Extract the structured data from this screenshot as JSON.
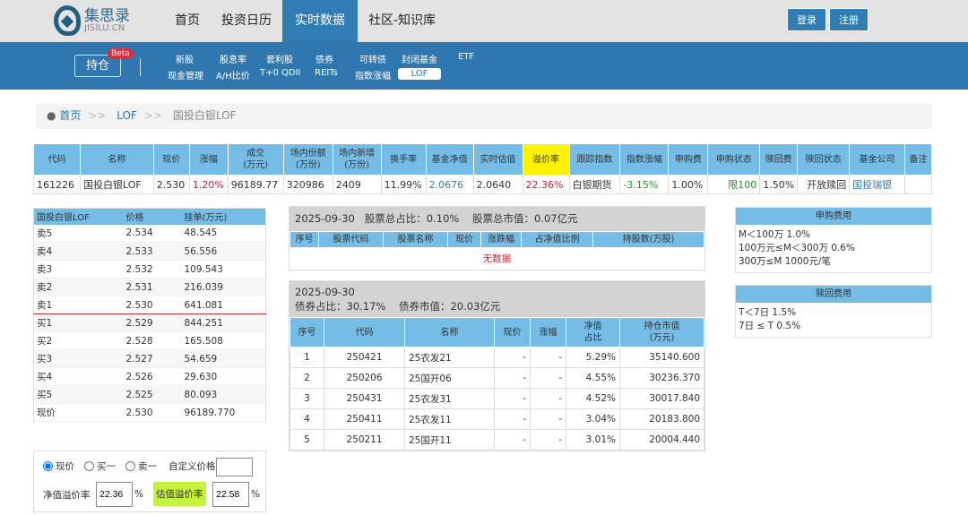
{
  "header": {
    "logo_cn": "集思录",
    "logo_en": "JISILU.CN",
    "nav": [
      "首页",
      "投资日历",
      "实时数据",
      "社区-知识库"
    ],
    "active_nav": "实时数据",
    "login": "登录",
    "register": "注册"
  },
  "subnav": {
    "hold": "持仓",
    "beta": "Beta",
    "row1": [
      "新股",
      "股息率",
      "套利股",
      "债券",
      "可转债",
      "封闭基金",
      "ETF"
    ],
    "row2": [
      "现金管理",
      "A/H比价",
      "T+0 QDII",
      "REITs",
      "指数涨幅",
      "LOF"
    ],
    "active": "LOF"
  },
  "breadcrumb": {
    "home": "首页",
    "lof": "LOF",
    "current": "国投白银LOF",
    "sep": ">>"
  },
  "main_table": {
    "headers": [
      "代码",
      "名称",
      "现价",
      "涨幅",
      "成交\n(万元)",
      "场内份额\n(万份)",
      "场内新增\n(万份)",
      "换手率",
      "基金净值",
      "实时估值",
      "溢价率",
      "跟踪指数",
      "指数涨幅",
      "申购费",
      "申购状态",
      "赎回费",
      "赎回状态",
      "基金公司",
      "备注"
    ],
    "row": [
      "161226",
      "国投白银LOF",
      "2.530",
      "1.20%",
      "96189.77",
      "320986",
      "2409",
      "11.99%",
      "2.0676",
      "2.0640",
      "22.36%",
      "白银期货",
      "-3.15%",
      "1.00%",
      "限100",
      "1.50%",
      "开放赎回",
      "国投瑞银",
      ""
    ]
  },
  "order_book": {
    "headers": [
      "国投白银LOF",
      "价格",
      "挂单(万元)"
    ],
    "rows": [
      [
        "卖5",
        "2.534",
        "48.545"
      ],
      [
        "卖4",
        "2.533",
        "56.556"
      ],
      [
        "卖3",
        "2.532",
        "109.543"
      ],
      [
        "卖2",
        "2.531",
        "216.039"
      ],
      [
        "卖1",
        "2.530",
        "641.081"
      ],
      [
        "买1",
        "2.529",
        "844.251"
      ],
      [
        "买2",
        "2.528",
        "165.508"
      ],
      [
        "买3",
        "2.527",
        "54.659"
      ],
      [
        "买4",
        "2.526",
        "29.630"
      ],
      [
        "买5",
        "2.525",
        "80.093"
      ],
      [
        "现价",
        "2.530",
        "96189.770"
      ]
    ]
  },
  "calc": {
    "opt_now": "现价",
    "opt_buy1": "买一",
    "opt_sell1": "卖一",
    "custom_label": "自定义价格",
    "custom_value": "",
    "nav_premium_label": "净值溢价率",
    "nav_premium": "22.36",
    "est_premium_label": "估值溢价率",
    "est_premium": "22.58",
    "pct": "%"
  },
  "stocks": {
    "date": "2025-09-30",
    "ratio_label": "股票总占比：0.10%",
    "value_label": "股票总市值：0.07亿元",
    "headers": [
      "序号",
      "股票代码",
      "股票名称",
      "现价",
      "涨跌幅",
      "占净值比例",
      "持股数(万股)"
    ],
    "empty": "无数据"
  },
  "bonds": {
    "date": "2025-09-30",
    "ratio_label": "债券占比：30.17%",
    "value_label": "债券市值：20.03亿元",
    "headers": [
      "序号",
      "代码",
      "名称",
      "现价",
      "涨幅",
      "净值\n占比",
      "持仓市值\n(万元)"
    ],
    "rows": [
      [
        "1",
        "250421",
        "25农发21",
        "-",
        "-",
        "5.29%",
        "35140.600"
      ],
      [
        "2",
        "250206",
        "25国开06",
        "-",
        "-",
        "4.55%",
        "30236.370"
      ],
      [
        "3",
        "250431",
        "25农发31",
        "-",
        "-",
        "4.52%",
        "30017.840"
      ],
      [
        "4",
        "250411",
        "25农发11",
        "-",
        "-",
        "3.04%",
        "20183.800"
      ],
      [
        "5",
        "250211",
        "25国开11",
        "-",
        "-",
        "3.01%",
        "20004.440"
      ]
    ]
  },
  "purchase_fee": {
    "title": "申购费用",
    "lines": [
      "M＜100万 1.0%",
      "100万元≤M＜300万 0.6%",
      "300万≤M 1000元/笔"
    ]
  },
  "redeem_fee": {
    "title": "赎回费用",
    "lines": [
      "T＜7日 1.5%",
      "7日 ≤ T 0.5%"
    ]
  }
}
